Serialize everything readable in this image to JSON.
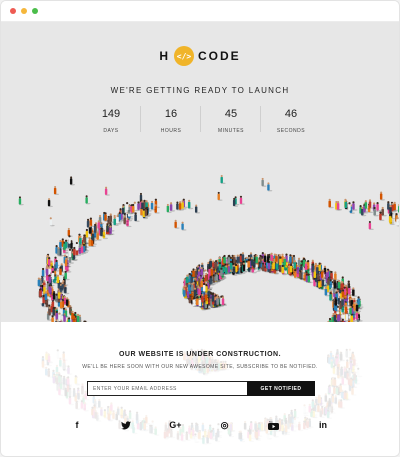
{
  "window": {
    "dots": [
      {
        "name": "close",
        "color": "#ee5b53"
      },
      {
        "name": "minimize",
        "color": "#f5b73b"
      },
      {
        "name": "maximize",
        "color": "#4bbd4a"
      }
    ]
  },
  "logo": {
    "left": "H",
    "icon": "</>",
    "right": "CODE",
    "accent": "#f0b429"
  },
  "hero": {
    "tagline": "WE'RE GETTING READY TO LAUNCH",
    "counter": [
      {
        "value": "149",
        "label": "DAYS"
      },
      {
        "value": "16",
        "label": "HOURS"
      },
      {
        "value": "45",
        "label": "MINUTES"
      },
      {
        "value": "46",
        "label": "SECONDS"
      }
    ]
  },
  "footer": {
    "heading": "OUR WEBSITE IS UNDER CONSTRUCTION.",
    "subtext": "WE'LL BE HERE SOON WITH OUR NEW AWESOME SITE, SUBSCRIBE TO BE NOTIFIED.",
    "email_placeholder": "ENTER YOUR EMAIL ADDRESS",
    "button": "GET NOTIFIED",
    "socials": [
      {
        "icon": "facebook-icon",
        "glyph": "f"
      },
      {
        "icon": "twitter-icon",
        "glyph": "🐦"
      },
      {
        "icon": "google-plus-icon",
        "glyph": "G+"
      },
      {
        "icon": "dribbble-icon",
        "glyph": "◎"
      },
      {
        "icon": "youtube-icon",
        "glyph": "▶"
      },
      {
        "icon": "linkedin-icon",
        "glyph": "in"
      }
    ]
  }
}
